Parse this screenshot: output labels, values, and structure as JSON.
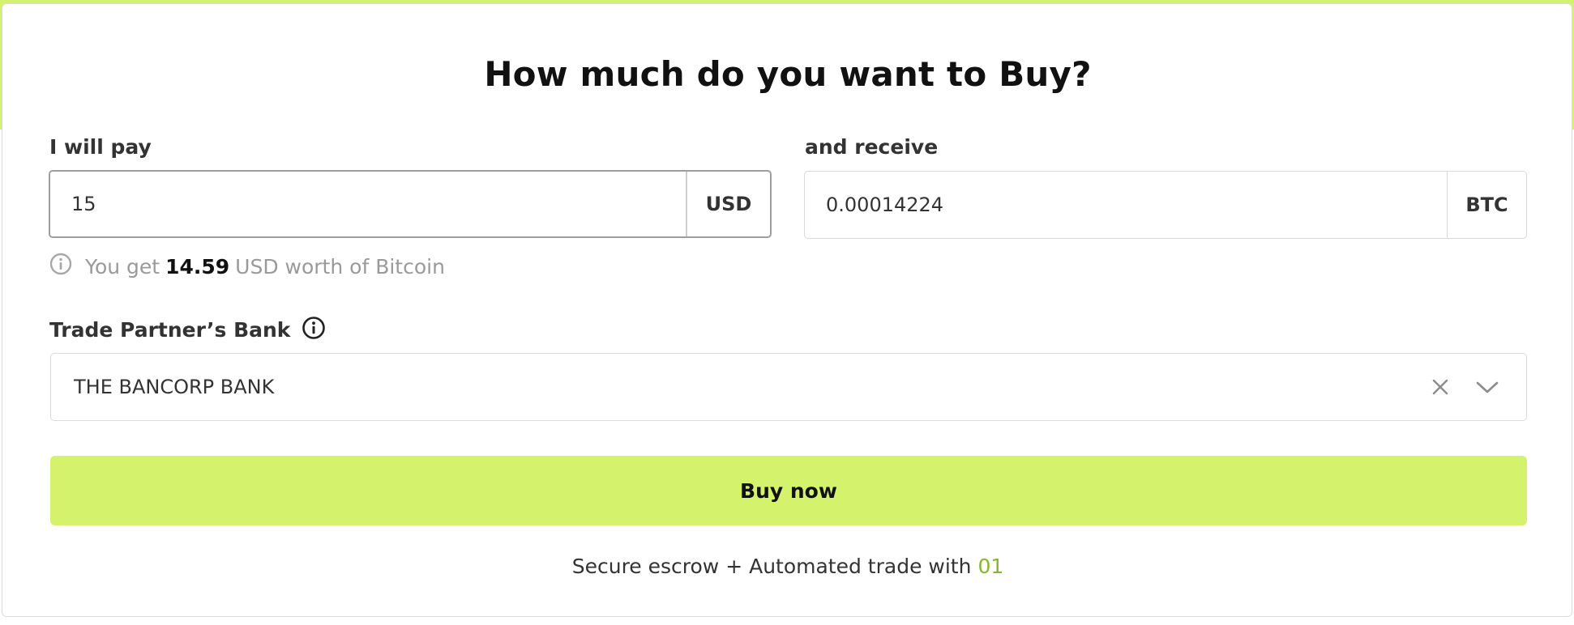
{
  "title": "How much do you want to Buy?",
  "pay": {
    "label": "I will pay",
    "value": "15",
    "currency": "USD"
  },
  "receive": {
    "label": "and receive",
    "value": "0.00014224",
    "currency": "BTC"
  },
  "hint": {
    "prefix": "You get",
    "amount": "14.59",
    "suffix": "USD worth of Bitcoin"
  },
  "bank": {
    "label": "Trade Partner’s Bank",
    "selected": "THE BANCORP BANK"
  },
  "buy_button": "Buy now",
  "footer": {
    "text": "Secure escrow + Automated trade with",
    "brand": "01"
  },
  "colors": {
    "accent": "#d4f26b",
    "brand_text": "#8ab62b"
  },
  "icons": {
    "info": "info-icon",
    "clear": "close-icon",
    "dropdown": "chevron-down-icon"
  }
}
